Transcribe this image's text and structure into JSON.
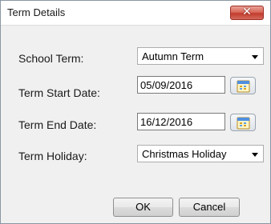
{
  "window": {
    "title": "Term Details",
    "close_glyph": "✕"
  },
  "form": {
    "school_term": {
      "label": "School Term:",
      "value": "Autumn Term"
    },
    "start_date": {
      "label": "Term Start Date:",
      "value": "05/09/2016"
    },
    "end_date": {
      "label": "Term End Date:",
      "value": "16/12/2016"
    },
    "holiday": {
      "label": "Term Holiday:",
      "value": "Christmas Holiday"
    }
  },
  "buttons": {
    "ok": "OK",
    "cancel": "Cancel"
  },
  "icons": {
    "close": "close-icon",
    "calendar": "calendar-icon",
    "dropdown": "chevron-down-icon"
  }
}
